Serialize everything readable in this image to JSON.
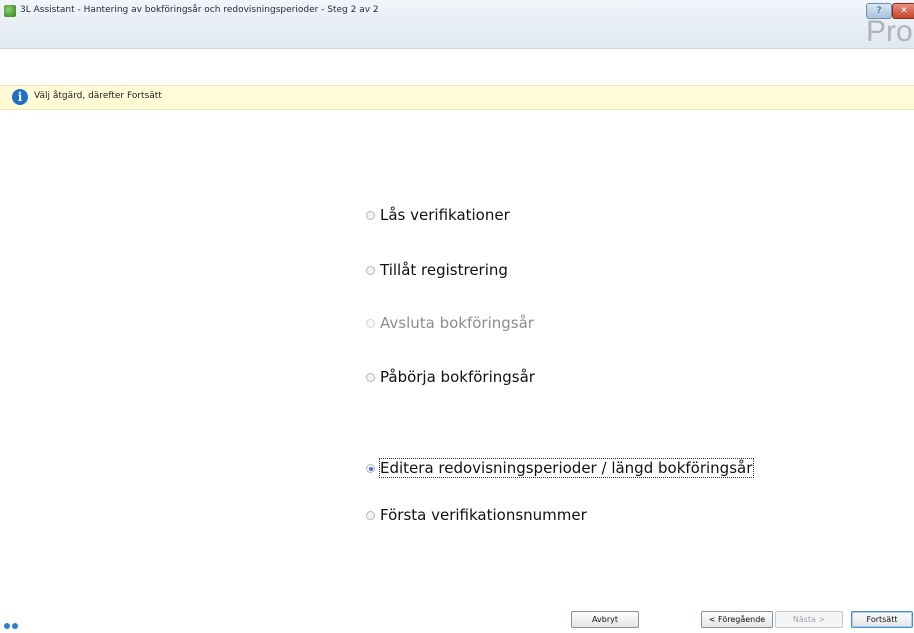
{
  "window": {
    "title": "3L Assistant - Hantering av bokföringsår och redovisningsperioder - Steg 2 av 2",
    "help_glyph": "?",
    "close_glyph": "✕",
    "brand_text": "Pro"
  },
  "info_bar": {
    "icon_glyph": "i",
    "message": "Välj åtgärd, därefter Fortsätt"
  },
  "options": [
    {
      "label": "Lås verifikationer",
      "selected": false,
      "enabled": true
    },
    {
      "label": "Tillåt registrering",
      "selected": false,
      "enabled": true
    },
    {
      "label": "Avsluta bokföringsår",
      "selected": false,
      "enabled": false
    },
    {
      "label": "Påbörja bokföringsår",
      "selected": false,
      "enabled": true
    },
    {
      "label": "Editera redovisningsperioder / längd bokföringsår",
      "selected": true,
      "enabled": true
    },
    {
      "label": "Första verifikationsnummer",
      "selected": false,
      "enabled": true
    }
  ],
  "buttons": {
    "cancel": "Avbryt",
    "previous": "< Föregående",
    "next": "Nästa >",
    "continue": "Fortsätt"
  },
  "colors": {
    "info_bar_bg": "#fffbd6",
    "info_icon": "#1f6fc9",
    "selected_radio": "#3c78d8",
    "titlebar": "#dfe7f1"
  }
}
